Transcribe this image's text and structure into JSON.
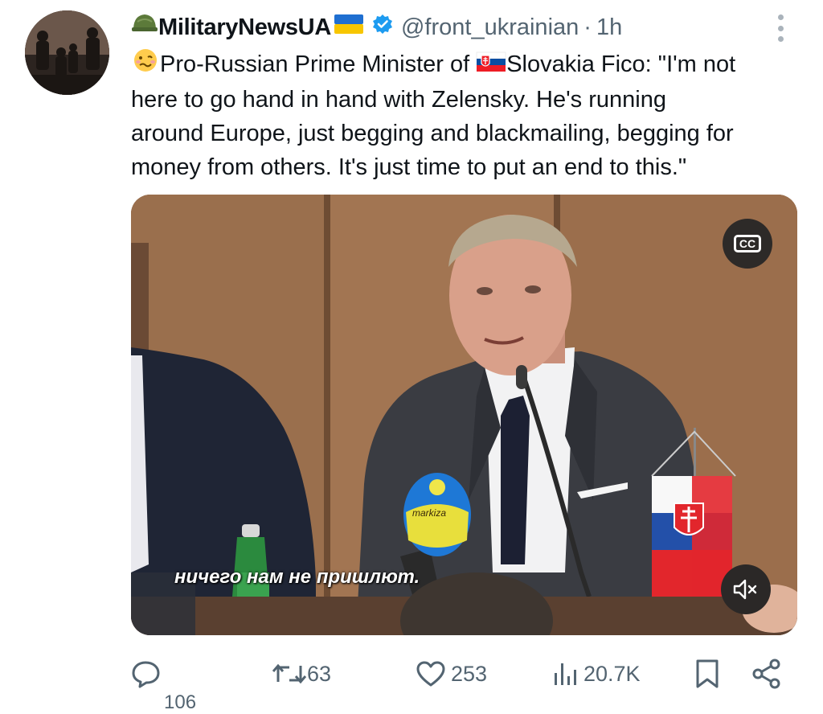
{
  "tweet": {
    "author": {
      "emoji_prefix": "military-helmet-icon",
      "display_name": "MilitaryNewsUA",
      "emoji_suffix": "ukraine-flag-icon",
      "verified": true,
      "handle": "@front_ukrainian",
      "separator": "·",
      "time": "1h"
    },
    "text": {
      "lines": [
        "Pro-Russian Prime Minister of ",
        "here to go hand in hand with Zelensky. He's running",
        "around Europe, just begging and blackmailing, begging for",
        "money from others. It's just time to put an end to this.\""
      ],
      "line1_tail": "Slovakia Fico: \"I'm not",
      "emoji_1": "woozy-face-icon",
      "emoji_2": "slovakia-flag-icon"
    },
    "media": {
      "type": "video",
      "caption_button": "CC",
      "subtitle": "ничего нам не пришлют.",
      "mic_brand": "markiza",
      "muted": true
    },
    "actions": {
      "reply_count": "106",
      "repost_count": "63",
      "like_count": "253",
      "view_count": "20.7K"
    }
  },
  "colors": {
    "text_primary": "#0f1419",
    "text_secondary": "#536471",
    "verified_blue": "#1d9bf0"
  }
}
